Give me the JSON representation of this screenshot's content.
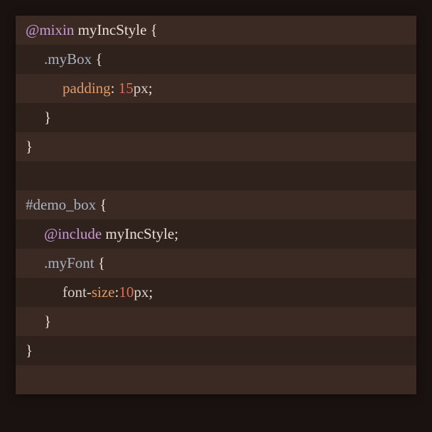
{
  "lines": [
    {
      "bg": "odd",
      "indent": 0,
      "tokens": [
        {
          "cls": "tok-atrule",
          "t": "@mixin"
        },
        {
          "cls": "tok-plain",
          "t": " "
        },
        {
          "cls": "tok-name",
          "t": "myIncStyle"
        },
        {
          "cls": "tok-plain",
          "t": " "
        },
        {
          "cls": "tok-punct",
          "t": "{"
        }
      ]
    },
    {
      "bg": "even",
      "indent": 1,
      "tokens": [
        {
          "cls": "tok-selector",
          "t": ".myBox"
        },
        {
          "cls": "tok-plain",
          "t": " "
        },
        {
          "cls": "tok-punct",
          "t": "{"
        }
      ]
    },
    {
      "bg": "odd",
      "indent": 2,
      "tokens": [
        {
          "cls": "tok-property",
          "t": "padding"
        },
        {
          "cls": "tok-punct",
          "t": ":"
        },
        {
          "cls": "tok-plain",
          "t": " "
        },
        {
          "cls": "tok-number",
          "t": "15"
        },
        {
          "cls": "tok-unit",
          "t": "px"
        },
        {
          "cls": "tok-punct",
          "t": ";"
        }
      ]
    },
    {
      "bg": "even",
      "indent": 1,
      "tokens": [
        {
          "cls": "tok-punct",
          "t": "}"
        }
      ]
    },
    {
      "bg": "odd",
      "indent": 0,
      "tokens": [
        {
          "cls": "tok-punct",
          "t": "}"
        }
      ]
    },
    {
      "bg": "even",
      "indent": 0,
      "tokens": []
    },
    {
      "bg": "odd",
      "indent": 0,
      "tokens": [
        {
          "cls": "tok-selector",
          "t": "#demo_box"
        },
        {
          "cls": "tok-plain",
          "t": " "
        },
        {
          "cls": "tok-punct",
          "t": "{"
        }
      ]
    },
    {
      "bg": "even",
      "indent": 1,
      "tokens": [
        {
          "cls": "tok-atrule",
          "t": "@include"
        },
        {
          "cls": "tok-plain",
          "t": " "
        },
        {
          "cls": "tok-name",
          "t": "myIncStyle"
        },
        {
          "cls": "tok-punct",
          "t": ";"
        }
      ]
    },
    {
      "bg": "odd",
      "indent": 1,
      "tokens": [
        {
          "cls": "tok-selector",
          "t": ".myFont"
        },
        {
          "cls": "tok-plain",
          "t": " "
        },
        {
          "cls": "tok-punct",
          "t": "{"
        }
      ]
    },
    {
      "bg": "even",
      "indent": 2,
      "tokens": [
        {
          "cls": "tok-plain",
          "t": "font-"
        },
        {
          "cls": "tok-property",
          "t": "size"
        },
        {
          "cls": "tok-punct",
          "t": ":"
        },
        {
          "cls": "tok-number",
          "t": "10"
        },
        {
          "cls": "tok-unit",
          "t": "px"
        },
        {
          "cls": "tok-punct",
          "t": ";"
        }
      ]
    },
    {
      "bg": "odd",
      "indent": 1,
      "tokens": [
        {
          "cls": "tok-punct",
          "t": "}"
        }
      ]
    },
    {
      "bg": "even",
      "indent": 0,
      "tokens": [
        {
          "cls": "tok-punct",
          "t": "}"
        }
      ]
    },
    {
      "bg": "odd",
      "indent": 0,
      "tokens": []
    }
  ]
}
